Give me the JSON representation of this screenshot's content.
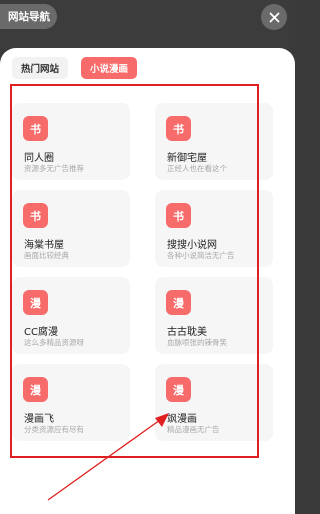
{
  "header": {
    "title": "网站导航",
    "close_icon": "close-icon"
  },
  "tabs": [
    {
      "label": "热门网站",
      "active": false
    },
    {
      "label": "小说漫画",
      "active": true
    }
  ],
  "cards": [
    {
      "icon_text": "书",
      "name": "同人圈",
      "desc": "资源多无广告推荐"
    },
    {
      "icon_text": "书",
      "name": "新御宅屋",
      "desc": "正经人也在看这个"
    },
    {
      "icon_text": "书",
      "name": "海棠书屋",
      "desc": "画面比较经典"
    },
    {
      "icon_text": "书",
      "name": "搜搜小说网",
      "desc": "各种小说简洁无广告"
    },
    {
      "icon_text": "漫",
      "name": "CC腐漫",
      "desc": "这么多精品资源呀"
    },
    {
      "icon_text": "漫",
      "name": "古古耽美",
      "desc": "血脉喷张的辣骨笑"
    },
    {
      "icon_text": "漫",
      "name": "漫画飞",
      "desc": "分类资源应有尽有"
    },
    {
      "icon_text": "漫",
      "name": "飒漫画",
      "desc": "精品漫画无广告"
    }
  ],
  "colors": {
    "accent": "#f86b6b",
    "annotation": "#e02020",
    "overlay": "#3a3a3a"
  }
}
